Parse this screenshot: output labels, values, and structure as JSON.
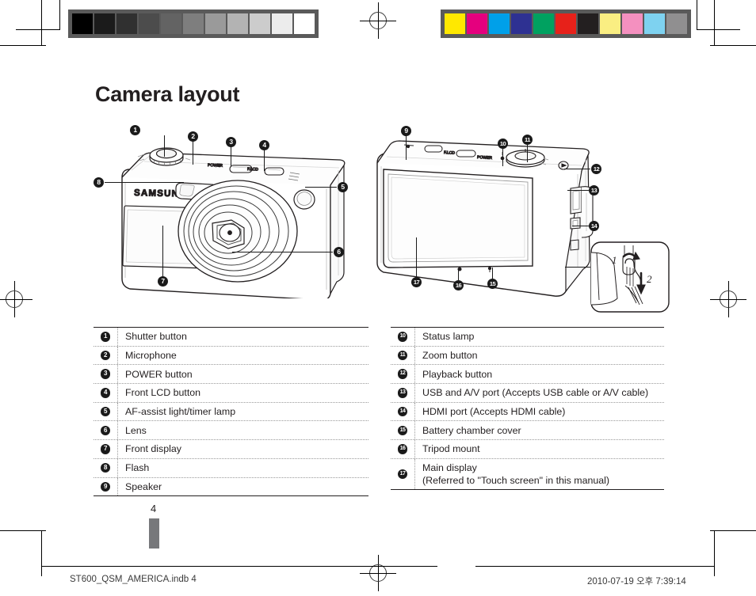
{
  "document": {
    "title": "Camera layout",
    "page_number": "4",
    "footer_left": "ST600_QSM_AMERICA.indb   4",
    "footer_right": "2010-07-19   오후 7:39:14"
  },
  "print_marks": {
    "grayscale_bar": {
      "name": "grayscale-calibration-bar",
      "swatches": [
        "#000000",
        "#1b1b1b",
        "#303030",
        "#4c4c4c",
        "#636363",
        "#7e7e7e",
        "#9a9a9a",
        "#b3b3b3",
        "#cccccc",
        "#ececec",
        "#ffffff"
      ]
    },
    "color_bar": {
      "name": "color-calibration-bar",
      "swatches": [
        "#ffe800",
        "#e5007e",
        "#00a0e9",
        "#2e3192",
        "#00a160",
        "#e7211a",
        "#231f20",
        "#faee82",
        "#f490bf",
        "#7ed2f0",
        "#908f90"
      ]
    }
  },
  "figures": {
    "front_view": {
      "name": "camera-front-view",
      "brand_label": "SAMSUNG",
      "top_labels": [
        "POWER",
        "F.LCD"
      ],
      "callouts": [
        "1",
        "2",
        "3",
        "4",
        "5",
        "6",
        "7",
        "8"
      ]
    },
    "back_view": {
      "name": "camera-back-view",
      "top_labels": [
        "F.LCD",
        "POWER"
      ],
      "callouts": [
        "9",
        "10",
        "11",
        "12",
        "13",
        "14",
        "15",
        "16",
        "17"
      ]
    },
    "strap_detail": {
      "name": "strap-attachment-detail",
      "steps": [
        "1",
        "2"
      ]
    }
  },
  "legend": {
    "left": [
      {
        "num": "1",
        "label": "Shutter button"
      },
      {
        "num": "2",
        "label": "Microphone"
      },
      {
        "num": "3",
        "label": "POWER button"
      },
      {
        "num": "4",
        "label": "Front LCD button"
      },
      {
        "num": "5",
        "label": "AF-assist light/timer lamp"
      },
      {
        "num": "6",
        "label": "Lens"
      },
      {
        "num": "7",
        "label": "Front display"
      },
      {
        "num": "8",
        "label": "Flash"
      },
      {
        "num": "9",
        "label": "Speaker"
      }
    ],
    "right": [
      {
        "num": "10",
        "label": "Status lamp"
      },
      {
        "num": "11",
        "label": "Zoom button"
      },
      {
        "num": "12",
        "label": "Playback button"
      },
      {
        "num": "13",
        "label": "USB and A/V port (Accepts USB cable or A/V cable)"
      },
      {
        "num": "14",
        "label": "HDMI port (Accepts HDMI cable)"
      },
      {
        "num": "15",
        "label": "Battery chamber cover"
      },
      {
        "num": "16",
        "label": "Tripod mount"
      },
      {
        "num": "17",
        "label": "Main display",
        "label2": "(Referred to \"Touch screen\" in this manual)"
      }
    ]
  }
}
